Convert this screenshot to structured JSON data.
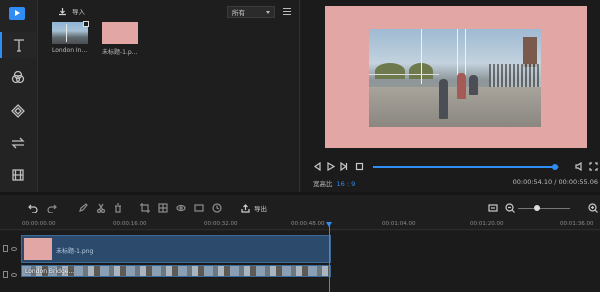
{
  "library": {
    "import_label": "导入",
    "filter_value": "所有",
    "items": [
      {
        "name": "London In...",
        "kind": "video"
      },
      {
        "name": "未标题-1.p...",
        "kind": "image"
      }
    ]
  },
  "preview": {
    "aspect_label": "宽高比",
    "aspect_value": "16 : 9",
    "timecode": "00:00:54.10 / 00:00:55.06",
    "progress_fraction": 0.98
  },
  "toolbar": {
    "export_label": "导出"
  },
  "ruler": {
    "ticks": [
      "00:00:00.00",
      "00:00:16.00",
      "00:00:32.00",
      "00:00:48.00",
      "00:01:04.00",
      "00:01:20.00",
      "00:01:36.00"
    ]
  },
  "timeline": {
    "image_clip_name": "未标题-1.png",
    "video_clip_name": "London Bridge..."
  },
  "colors": {
    "accent": "#2f8df5",
    "canvas_bg": "#e2a6a5"
  }
}
